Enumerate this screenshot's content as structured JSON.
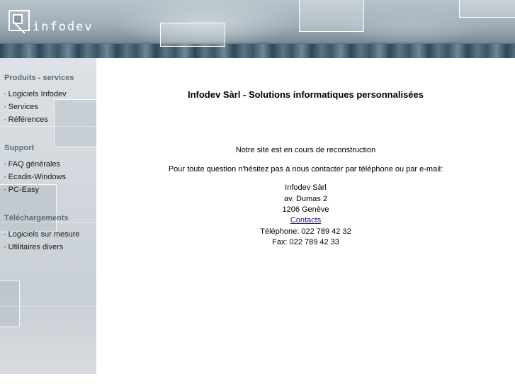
{
  "header": {
    "logo_text": "infodev"
  },
  "sidebar": {
    "sections": [
      {
        "title": "Produits - services",
        "items": [
          "Logiciels Infodev",
          "Services",
          "Références"
        ]
      },
      {
        "title": "Support",
        "items": [
          "FAQ générales",
          "Ecadis-Windows",
          "PC-Easy"
        ]
      },
      {
        "title": "Téléchargements",
        "items": [
          "Logiciels sur mesure",
          "Utilitaires divers"
        ]
      }
    ],
    "bullet": "·"
  },
  "main": {
    "title": "Infodev Sàrl - Solutions informatiques personnalisées",
    "notice": "Notre site est en cours de reconstruction",
    "contact_prompt": "Pour toute question n'hésitez pas à nous contacter par téléphone ou par e-mail:",
    "address": {
      "company": "Infodev Sàrl",
      "street": "av. Dumas 2",
      "city": "1206 Genève",
      "contacts_link": "Contacts",
      "phone": "Téléphone: 022 789 42 32",
      "fax": "Fax: 022 789 42 33"
    }
  },
  "colors": {
    "section_heading": "#5d6f7b",
    "link": "#1a1a8c",
    "header_band": "#36505e"
  }
}
